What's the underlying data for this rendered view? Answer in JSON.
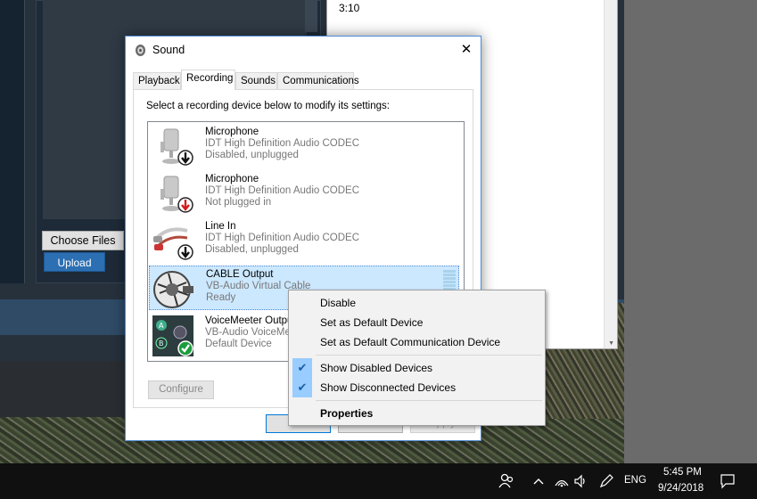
{
  "background": {
    "choose_files_label": "Choose Files",
    "upload_label": "Upload",
    "window_text": "3:10"
  },
  "dialog": {
    "title": "Sound",
    "close_glyph": "✕",
    "tabs": [
      {
        "label": "Playback"
      },
      {
        "label": "Recording"
      },
      {
        "label": "Sounds"
      },
      {
        "label": "Communications"
      }
    ],
    "active_tab": "Recording",
    "instruction": "Select a recording device below to modify its settings:",
    "devices": [
      {
        "name": "Microphone",
        "driver": "IDT High Definition Audio CODEC",
        "status": "Disabled, unplugged",
        "icon": "microphone-disabled-icon"
      },
      {
        "name": "Microphone",
        "driver": "IDT High Definition Audio CODEC",
        "status": "Not plugged in",
        "icon": "microphone-unplugged-icon"
      },
      {
        "name": "Line In",
        "driver": "IDT High Definition Audio CODEC",
        "status": "Disabled, unplugged",
        "icon": "line-in-cable-icon"
      },
      {
        "name": "CABLE Output",
        "driver": "VB-Audio Virtual Cable",
        "status": "Ready",
        "icon": "cable-output-icon",
        "selected": true
      },
      {
        "name": "VoiceMeeter Output",
        "driver": "VB-Audio VoiceMeeter VAIO",
        "status": "Default Device",
        "icon": "voicemeeter-icon"
      }
    ],
    "configure_label": "Configure",
    "ok_label": "OK",
    "cancel_label": "Cancel",
    "apply_label": "Apply"
  },
  "context_menu": {
    "items": [
      {
        "label": "Disable",
        "checked": false
      },
      {
        "label": "Set as Default Device",
        "checked": false
      },
      {
        "label": "Set as Default Communication Device",
        "checked": false
      },
      {
        "label": "Show Disabled Devices",
        "checked": true
      },
      {
        "label": "Show Disconnected Devices",
        "checked": true
      },
      {
        "label": "Properties",
        "bold": true
      }
    ],
    "check_glyph": "✔"
  },
  "taskbar": {
    "language": "ENG",
    "time": "5:45 PM",
    "date": "9/24/2018",
    "icons": [
      "people-icon",
      "chevron-up-icon",
      "wifi-icon",
      "volume-icon",
      "pen-icon",
      "notification-icon"
    ]
  },
  "colors": {
    "accent": "#0078d7",
    "selection": "#cce8ff",
    "menu_check_bg": "#99ccff",
    "upload_button": "#2c6fb3"
  }
}
